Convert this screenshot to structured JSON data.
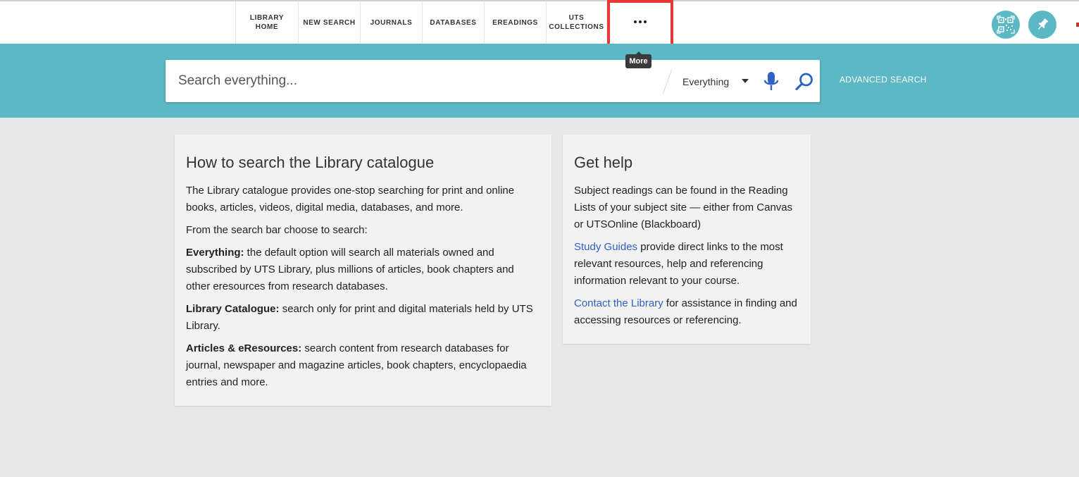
{
  "nav": {
    "items": [
      {
        "line1": "LIBRARY",
        "line2": "HOME"
      },
      {
        "line1": "NEW SEARCH",
        "line2": ""
      },
      {
        "line1": "JOURNALS",
        "line2": ""
      },
      {
        "line1": "DATABASES",
        "line2": ""
      },
      {
        "line1": "EREADINGS",
        "line2": ""
      },
      {
        "line1": "UTS",
        "line2": "COLLECTIONS"
      }
    ],
    "more_tooltip": "More"
  },
  "icons": {
    "qr": "qr-code-icon",
    "pin": "pin-icon",
    "mic": "microphone-icon",
    "search": "search-icon",
    "more": "more-dots-icon"
  },
  "colors": {
    "band": "#5bb8c4",
    "highlight": "#e53935",
    "link": "#2f62c5",
    "icon_blue": "#2f62c5"
  },
  "search": {
    "placeholder": "Search everything...",
    "scope": "Everything",
    "advanced": "ADVANCED SEARCH"
  },
  "how_to": {
    "title": "How to search the Library catalogue",
    "intro": "The Library catalogue provides one-stop searching for print and online books, articles, videos, digital media, databases, and more.",
    "choose": "From the search bar choose to search:",
    "opt1_label": "Everything:",
    "opt1_text": " the default option will search all materials owned and subscribed by UTS Library, plus millions of articles, book chapters and other eresources from research databases.",
    "opt2_label": "Library Catalogue:",
    "opt2_text": " search only for print and digital materials held by UTS Library.",
    "opt3_label": "Articles & eResources:",
    "opt3_text": " search content from research databases for journal, newspaper and magazine articles, book chapters, encyclopaedia entries and more."
  },
  "help": {
    "title": "Get help",
    "p1": "Subject readings can be found in the Reading Lists of your subject site — either from Canvas or UTSOnline (Blackboard)",
    "p2_link": "Study Guides",
    "p2_text": " provide direct links to the most relevant resources, help and referencing information relevant to your course.",
    "p3_link": "Contact the Library",
    "p3_text": " for assistance in finding and accessing resources or referencing."
  }
}
